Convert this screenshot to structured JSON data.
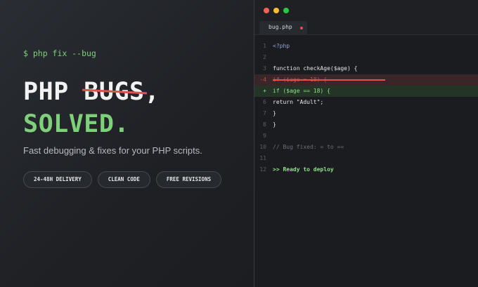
{
  "hero": {
    "prompt": "$ php fix --bug",
    "headline_word1": "PHP",
    "headline_bugs": "BUGS",
    "headline_comma": ",",
    "headline_solved": "SOLVED.",
    "tagline": "Fast debugging & fixes for your PHP scripts.",
    "badges": [
      "24-48H DELIVERY",
      "CLEAN CODE",
      "FREE REVISIONS"
    ]
  },
  "editor": {
    "tab_label": "bug.php",
    "lines": [
      {
        "num": "1",
        "text": "<?php",
        "kind": "php"
      },
      {
        "num": "2",
        "text": "",
        "kind": "normal"
      },
      {
        "num": "3",
        "text": "function checkAge($age) {",
        "kind": "normal"
      },
      {
        "num": "-4",
        "text": "if ($age = 18) {",
        "kind": "del"
      },
      {
        "num": "+",
        "text": "if ($age == 18) {",
        "kind": "add"
      },
      {
        "num": "6",
        "text": "return \"Adult\";",
        "kind": "normal"
      },
      {
        "num": "7",
        "text": "}",
        "kind": "normal"
      },
      {
        "num": "8",
        "text": "}",
        "kind": "normal"
      },
      {
        "num": "9",
        "text": "",
        "kind": "normal"
      },
      {
        "num": "10",
        "text": "// Bug fixed: = to ==",
        "kind": "comment"
      },
      {
        "num": "11",
        "text": "",
        "kind": "normal"
      },
      {
        "num": "12",
        "text": ">> Ready to deploy",
        "kind": "ok"
      }
    ]
  },
  "colors": {
    "accent_green": "#7ed17a",
    "accent_red": "#e0524d",
    "background": "#1e2024"
  }
}
